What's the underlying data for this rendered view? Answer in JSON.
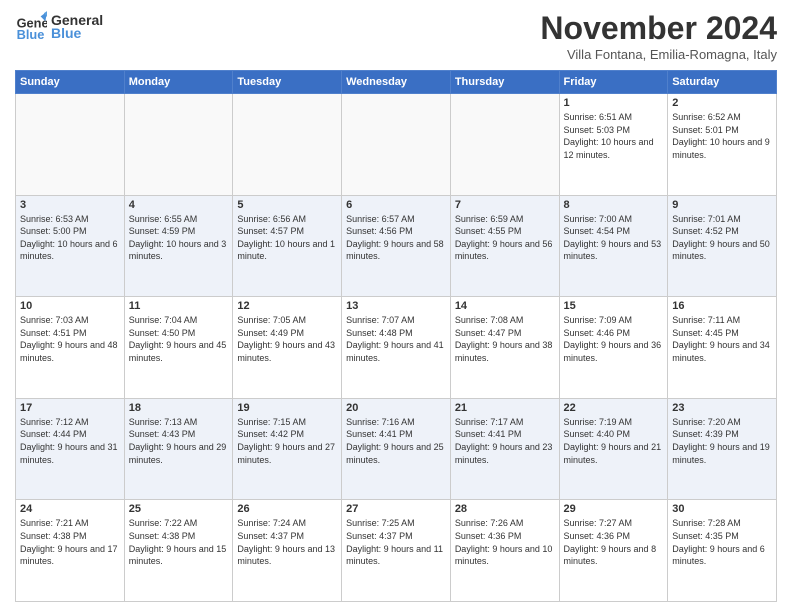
{
  "logo": {
    "line1": "General",
    "line2": "Blue"
  },
  "title": "November 2024",
  "subtitle": "Villa Fontana, Emilia-Romagna, Italy",
  "days_of_week": [
    "Sunday",
    "Monday",
    "Tuesday",
    "Wednesday",
    "Thursday",
    "Friday",
    "Saturday"
  ],
  "weeks": [
    [
      {
        "day": "",
        "info": ""
      },
      {
        "day": "",
        "info": ""
      },
      {
        "day": "",
        "info": ""
      },
      {
        "day": "",
        "info": ""
      },
      {
        "day": "",
        "info": ""
      },
      {
        "day": "1",
        "info": "Sunrise: 6:51 AM\nSunset: 5:03 PM\nDaylight: 10 hours and 12 minutes."
      },
      {
        "day": "2",
        "info": "Sunrise: 6:52 AM\nSunset: 5:01 PM\nDaylight: 10 hours and 9 minutes."
      }
    ],
    [
      {
        "day": "3",
        "info": "Sunrise: 6:53 AM\nSunset: 5:00 PM\nDaylight: 10 hours and 6 minutes."
      },
      {
        "day": "4",
        "info": "Sunrise: 6:55 AM\nSunset: 4:59 PM\nDaylight: 10 hours and 3 minutes."
      },
      {
        "day": "5",
        "info": "Sunrise: 6:56 AM\nSunset: 4:57 PM\nDaylight: 10 hours and 1 minute."
      },
      {
        "day": "6",
        "info": "Sunrise: 6:57 AM\nSunset: 4:56 PM\nDaylight: 9 hours and 58 minutes."
      },
      {
        "day": "7",
        "info": "Sunrise: 6:59 AM\nSunset: 4:55 PM\nDaylight: 9 hours and 56 minutes."
      },
      {
        "day": "8",
        "info": "Sunrise: 7:00 AM\nSunset: 4:54 PM\nDaylight: 9 hours and 53 minutes."
      },
      {
        "day": "9",
        "info": "Sunrise: 7:01 AM\nSunset: 4:52 PM\nDaylight: 9 hours and 50 minutes."
      }
    ],
    [
      {
        "day": "10",
        "info": "Sunrise: 7:03 AM\nSunset: 4:51 PM\nDaylight: 9 hours and 48 minutes."
      },
      {
        "day": "11",
        "info": "Sunrise: 7:04 AM\nSunset: 4:50 PM\nDaylight: 9 hours and 45 minutes."
      },
      {
        "day": "12",
        "info": "Sunrise: 7:05 AM\nSunset: 4:49 PM\nDaylight: 9 hours and 43 minutes."
      },
      {
        "day": "13",
        "info": "Sunrise: 7:07 AM\nSunset: 4:48 PM\nDaylight: 9 hours and 41 minutes."
      },
      {
        "day": "14",
        "info": "Sunrise: 7:08 AM\nSunset: 4:47 PM\nDaylight: 9 hours and 38 minutes."
      },
      {
        "day": "15",
        "info": "Sunrise: 7:09 AM\nSunset: 4:46 PM\nDaylight: 9 hours and 36 minutes."
      },
      {
        "day": "16",
        "info": "Sunrise: 7:11 AM\nSunset: 4:45 PM\nDaylight: 9 hours and 34 minutes."
      }
    ],
    [
      {
        "day": "17",
        "info": "Sunrise: 7:12 AM\nSunset: 4:44 PM\nDaylight: 9 hours and 31 minutes."
      },
      {
        "day": "18",
        "info": "Sunrise: 7:13 AM\nSunset: 4:43 PM\nDaylight: 9 hours and 29 minutes."
      },
      {
        "day": "19",
        "info": "Sunrise: 7:15 AM\nSunset: 4:42 PM\nDaylight: 9 hours and 27 minutes."
      },
      {
        "day": "20",
        "info": "Sunrise: 7:16 AM\nSunset: 4:41 PM\nDaylight: 9 hours and 25 minutes."
      },
      {
        "day": "21",
        "info": "Sunrise: 7:17 AM\nSunset: 4:41 PM\nDaylight: 9 hours and 23 minutes."
      },
      {
        "day": "22",
        "info": "Sunrise: 7:19 AM\nSunset: 4:40 PM\nDaylight: 9 hours and 21 minutes."
      },
      {
        "day": "23",
        "info": "Sunrise: 7:20 AM\nSunset: 4:39 PM\nDaylight: 9 hours and 19 minutes."
      }
    ],
    [
      {
        "day": "24",
        "info": "Sunrise: 7:21 AM\nSunset: 4:38 PM\nDaylight: 9 hours and 17 minutes."
      },
      {
        "day": "25",
        "info": "Sunrise: 7:22 AM\nSunset: 4:38 PM\nDaylight: 9 hours and 15 minutes."
      },
      {
        "day": "26",
        "info": "Sunrise: 7:24 AM\nSunset: 4:37 PM\nDaylight: 9 hours and 13 minutes."
      },
      {
        "day": "27",
        "info": "Sunrise: 7:25 AM\nSunset: 4:37 PM\nDaylight: 9 hours and 11 minutes."
      },
      {
        "day": "28",
        "info": "Sunrise: 7:26 AM\nSunset: 4:36 PM\nDaylight: 9 hours and 10 minutes."
      },
      {
        "day": "29",
        "info": "Sunrise: 7:27 AM\nSunset: 4:36 PM\nDaylight: 9 hours and 8 minutes."
      },
      {
        "day": "30",
        "info": "Sunrise: 7:28 AM\nSunset: 4:35 PM\nDaylight: 9 hours and 6 minutes."
      }
    ]
  ]
}
